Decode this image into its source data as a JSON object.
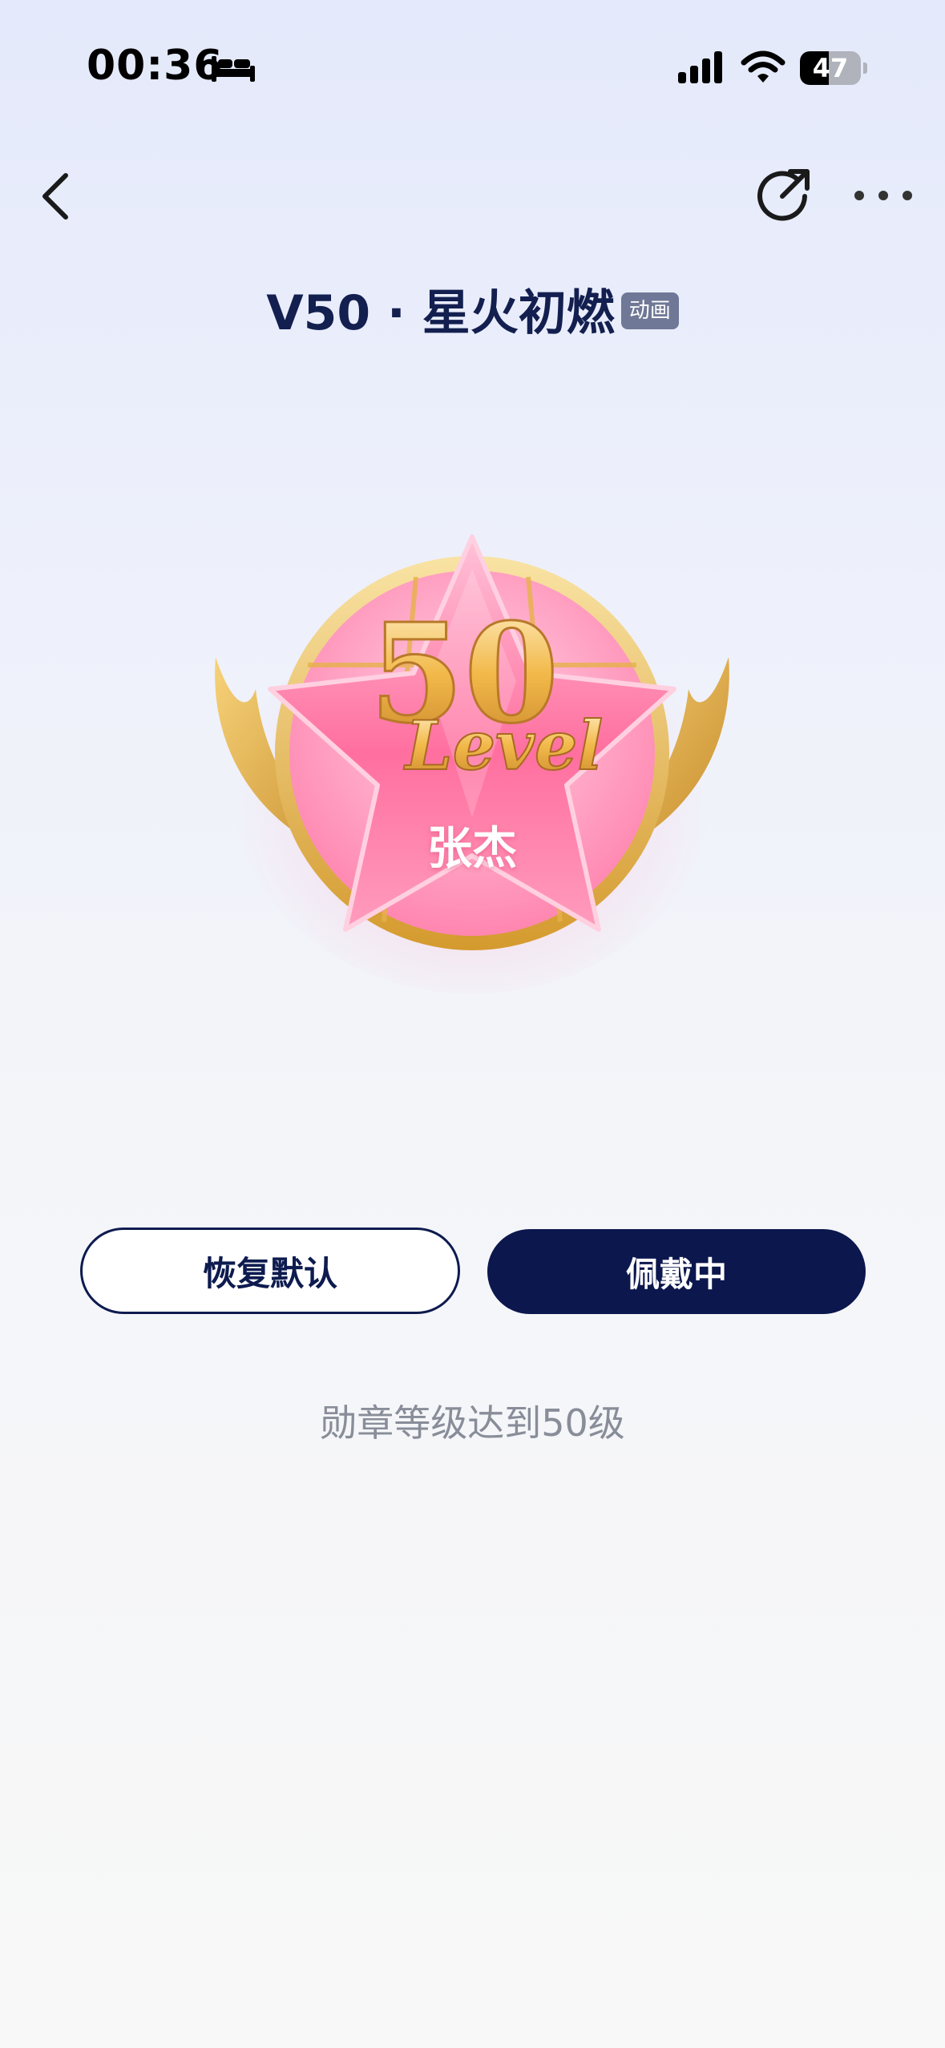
{
  "status_bar": {
    "time": "00:36",
    "battery_percent": "47",
    "battery_level": 0.47
  },
  "header": {
    "title": "V50 · 星火初燃",
    "badge": "动画"
  },
  "medal": {
    "level_number": "50",
    "level_script": "Level",
    "name": "张杰"
  },
  "actions": {
    "restore_label": "恢复默认",
    "wearing_label": "佩戴中"
  },
  "description": "勋章等级达到50级",
  "icons": [
    "bed-icon",
    "signal-icon",
    "wifi-icon",
    "battery-icon",
    "back-arrow-icon",
    "share-icon",
    "more-icon"
  ],
  "colors": {
    "primary": "#0b174d",
    "badge_bg": "#6f7896",
    "description_text": "#888d99"
  }
}
